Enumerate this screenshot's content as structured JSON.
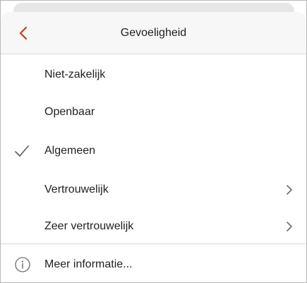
{
  "header": {
    "title": "Gevoeligheid",
    "back_icon": "chevron-left-icon",
    "accent_color": "#c43e1c"
  },
  "options": [
    {
      "label": "Niet-zakelijk",
      "selected": false,
      "has_submenu": false
    },
    {
      "label": "Openbaar",
      "selected": false,
      "has_submenu": false
    },
    {
      "label": "Algemeen",
      "selected": true,
      "has_submenu": false
    },
    {
      "label": "Vertrouwelijk",
      "selected": false,
      "has_submenu": true
    },
    {
      "label": "Zeer vertrouwelijk",
      "selected": false,
      "has_submenu": true
    }
  ],
  "footer": {
    "more_info_label": "Meer informatie...",
    "icon": "info-icon"
  }
}
